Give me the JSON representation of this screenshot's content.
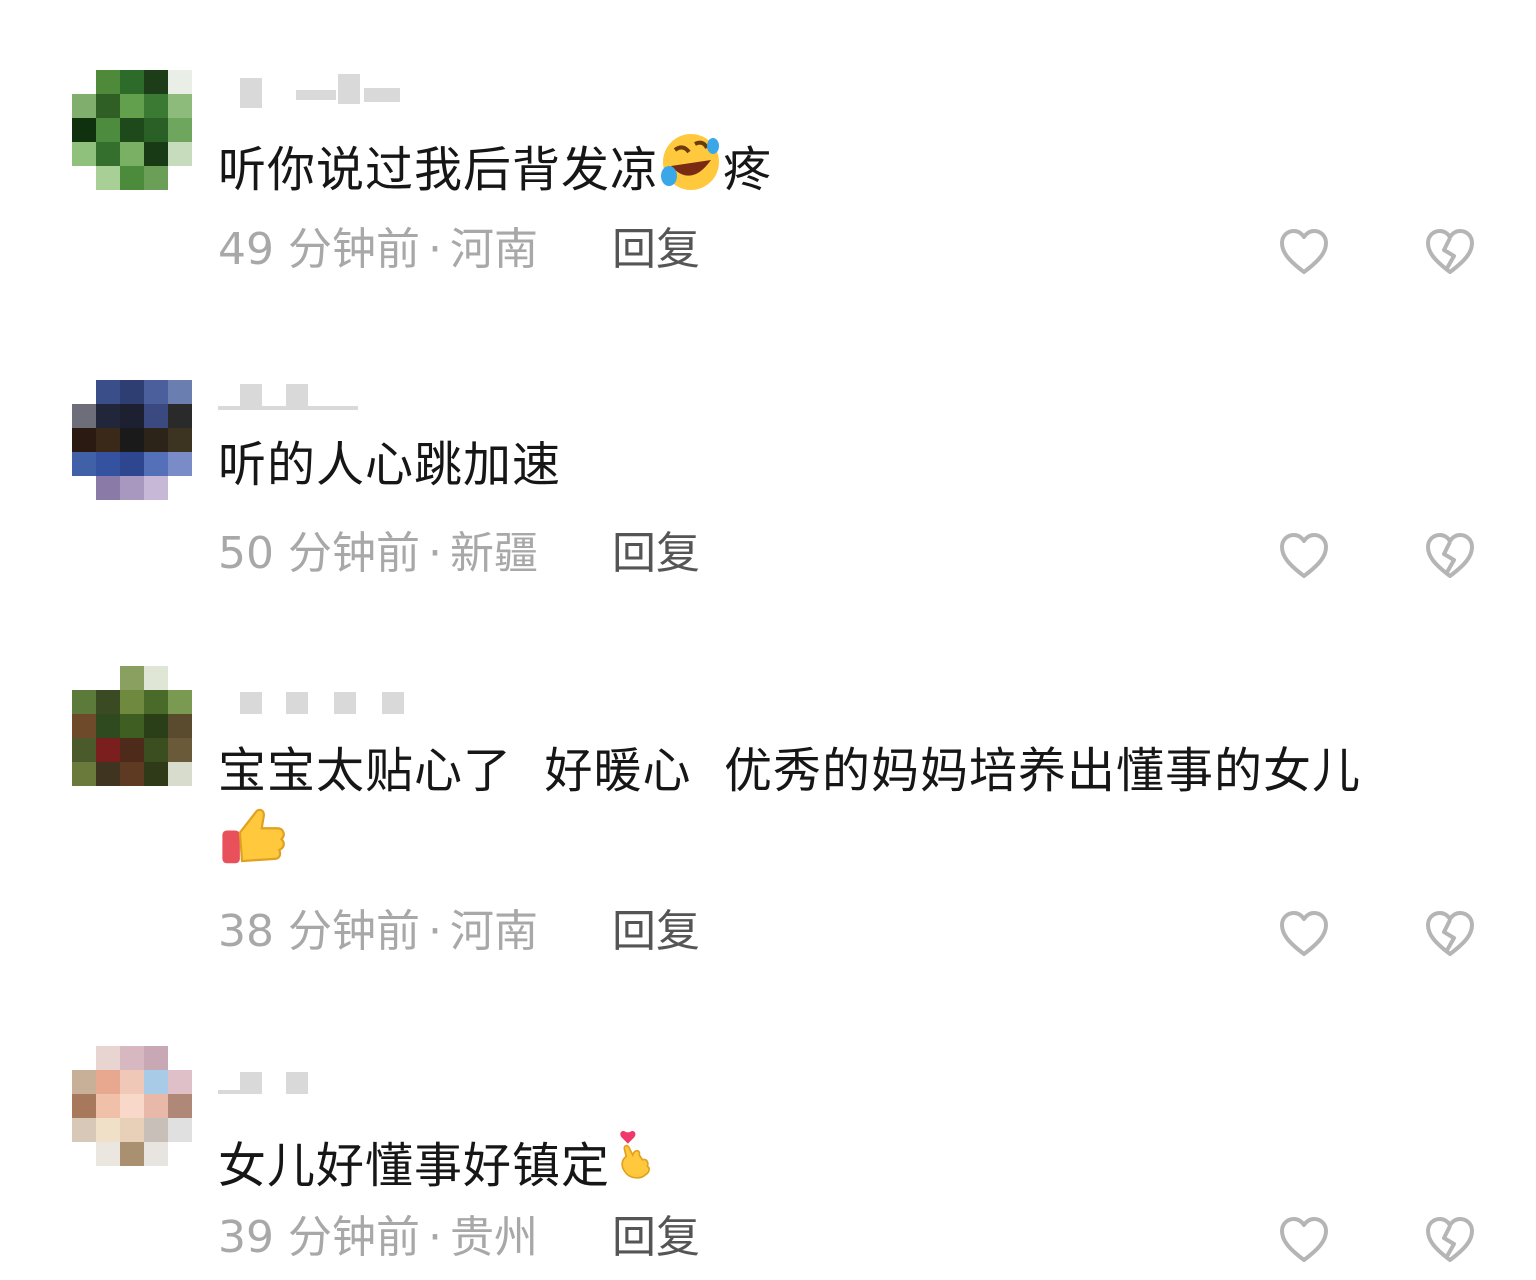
{
  "comments": [
    {
      "text": "听你说过我后背发凉",
      "emoji": "rolling-on-floor-laughing-emoji",
      "text_after": "疼",
      "time": "49 分钟前",
      "location": "河南",
      "reply_label": "回复"
    },
    {
      "text": "听的人心跳加速",
      "time": "50 分钟前",
      "location": "新疆",
      "reply_label": "回复"
    },
    {
      "text": "宝宝太贴心了  好暖心  优秀的妈妈培养出懂事的女儿",
      "emoji": "thumbs-up-emoji",
      "time": "38 分钟前",
      "location": "河南",
      "reply_label": "回复"
    },
    {
      "text": "女儿好懂事好镇定",
      "emoji": "finger-heart-emoji",
      "time": "39 分钟前",
      "location": "贵州",
      "reply_label": "回复"
    }
  ],
  "meta_separator": "·",
  "icons": {
    "like": "heart-outline-icon",
    "dislike": "broken-heart-outline-icon",
    "icon_color": "#b5b5b5"
  }
}
